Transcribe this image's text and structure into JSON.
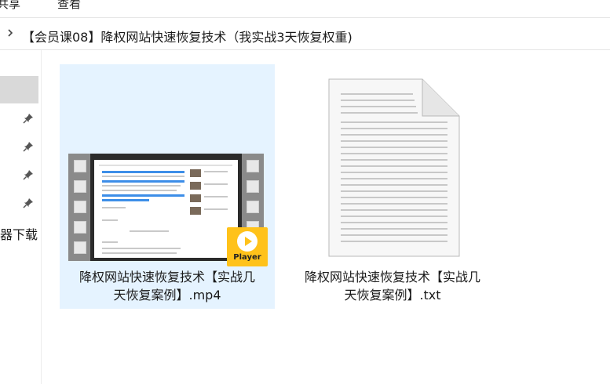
{
  "ribbon": {
    "tabs": [
      "共享",
      "查看"
    ]
  },
  "address": {
    "path": "【会员课08】降权网站快速恢复技术（我实战3天恢复权重)"
  },
  "nav": {
    "partial_label": "器下载"
  },
  "files": [
    {
      "line1": "降权网站快速恢复技术【实战几",
      "line2": "天恢复案例】.mp4",
      "type": "video",
      "selected": true
    },
    {
      "line1": "降权网站快速恢复技术【实战几",
      "line2": "天恢复案例】.txt",
      "type": "text",
      "selected": false
    }
  ],
  "video_badge": {
    "label": "Player",
    "color": "#ffc21a"
  },
  "colors": {
    "selection": "#e5f3ff",
    "nav_selected": "#d9d9d9"
  },
  "icons": [
    "chevron-right-icon",
    "pin-icon",
    "video-file-icon",
    "player-badge-icon",
    "text-file-icon"
  ]
}
